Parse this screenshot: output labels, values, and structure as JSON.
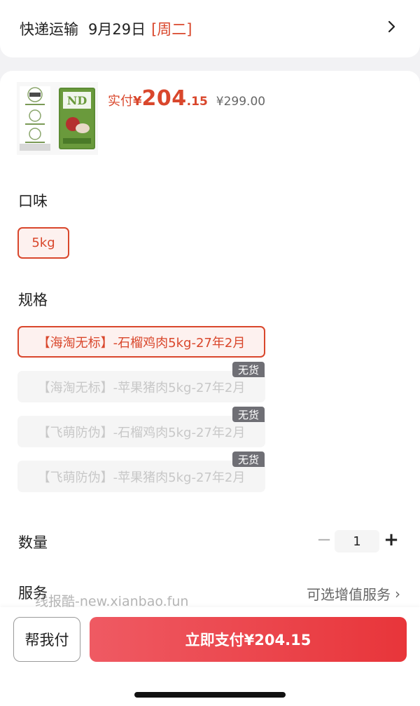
{
  "shipping": {
    "label": "快递运输",
    "date": "9月29日",
    "weekday": "[周二]",
    "chevron_icon": "chevron-right-icon"
  },
  "product": {
    "image_icon": "product-image",
    "price_label": "实付",
    "price_currency": "¥",
    "price_integer": "204",
    "price_decimal": ".15",
    "original_price": "¥299.00"
  },
  "flavor": {
    "title": "口味",
    "options": [
      {
        "label": "5kg",
        "state": "selected"
      }
    ]
  },
  "spec": {
    "title": "规格",
    "options": [
      {
        "label": "【海淘无标】-石榴鸡肉5kg-27年2月",
        "state": "selected",
        "tag": ""
      },
      {
        "label": "【海淘无标】-苹果猪肉5kg-27年2月",
        "state": "disabled",
        "tag": "无货"
      },
      {
        "label": "【飞萌防伪】-石榴鸡肉5kg-27年2月",
        "state": "disabled",
        "tag": "无货"
      },
      {
        "label": "【飞萌防伪】-苹果猪肉5kg-27年2月",
        "state": "disabled",
        "tag": "无货"
      }
    ]
  },
  "quantity": {
    "title": "数量",
    "minus": "−",
    "value": "1",
    "plus": "+"
  },
  "service": {
    "title": "服务",
    "link": "可选增值服务",
    "arrow": "›"
  },
  "watermark": "线报酷-new.xianbao.fun",
  "bottom": {
    "help_label": "帮我付",
    "pay_label": "立即支付¥204.15"
  },
  "colors": {
    "accent": "#d9472c",
    "pay_gradient_start": "#ef5a63",
    "pay_gradient_end": "#e8353a",
    "out_of_stock_tag": "#6f6f75"
  }
}
